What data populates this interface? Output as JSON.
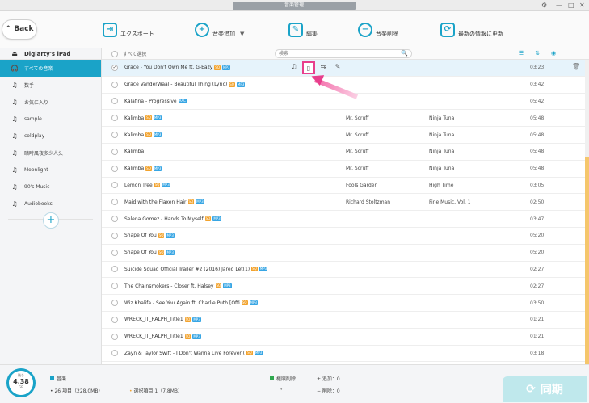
{
  "window": {
    "title": "音楽管理",
    "settings_icon": "⚙",
    "min_icon": "—",
    "max_icon": "□",
    "close_icon": "✕"
  },
  "toolbar": {
    "back_label": "Back",
    "back_icon": "⌃",
    "export_label": "エクスポート",
    "add_music_label": "音楽追加",
    "dropdown_icon": "▼",
    "edit_label": "編集",
    "delete_label": "音楽削除",
    "refresh_label": "最新の情報に更新"
  },
  "sidebar": {
    "device_name": "Digiarty's iPad",
    "items": [
      {
        "label": "すべての音楽",
        "icon": "🎧"
      },
      {
        "label": "数手",
        "icon": "♫"
      },
      {
        "label": "お気に入り",
        "icon": "♫"
      },
      {
        "label": "sample",
        "icon": "♫"
      },
      {
        "label": "coldplay",
        "icon": "♫"
      },
      {
        "label": "暗時風夜多少人头",
        "icon": "♫"
      },
      {
        "label": "Moonlight",
        "icon": "♫"
      },
      {
        "label": "90's Music",
        "icon": "♫"
      },
      {
        "label": "Audiobooks",
        "icon": "♫"
      }
    ],
    "add_icon": "+"
  },
  "list": {
    "select_all_label": "すべて選択",
    "search_placeholder": "検索",
    "search_icon": "🔍",
    "view_icons": [
      "☰",
      "⇅",
      "◉"
    ],
    "rows": [
      {
        "title": "Grace - You Don't Own Me ft. G-Eazy",
        "badges": [
          "SQ",
          "MP3"
        ],
        "artist": "",
        "album": "",
        "time": "03:23",
        "checked": "✓"
      },
      {
        "title": "Grace VanderWaal - Beautiful Thing (Lyric)",
        "badges": [
          "SQ",
          "MP3"
        ],
        "artist": "",
        "album": "",
        "time": "03:42",
        "checked": ""
      },
      {
        "title": "Kalafina - Progressive",
        "badges": [
          "AAC"
        ],
        "artist": "",
        "album": "",
        "time": "05:42",
        "checked": ""
      },
      {
        "title": "Kalimba",
        "badges": [
          "SQ",
          "MP3"
        ],
        "artist": "Mr. Scruff",
        "album": "Ninja Tuna",
        "time": "05:48",
        "checked": ""
      },
      {
        "title": "Kalimba",
        "badges": [
          "SQ",
          "MP3"
        ],
        "artist": "Mr. Scruff",
        "album": "Ninja Tuna",
        "time": "05:48",
        "checked": ""
      },
      {
        "title": "Kalimba",
        "badges": [],
        "artist": "Mr. Scruff",
        "album": "Ninja Tuna",
        "time": "05:48",
        "checked": ""
      },
      {
        "title": "Kalimba",
        "badges": [
          "SQ",
          "MP3"
        ],
        "artist": "Mr. Scruff",
        "album": "Ninja Tuna",
        "time": "05:48",
        "checked": ""
      },
      {
        "title": "Lemon Tree",
        "badges": [
          "SQ",
          "MP3"
        ],
        "artist": "Fools Garden",
        "album": "High Time",
        "time": "03:05",
        "checked": ""
      },
      {
        "title": "Maid with the Flaxen Hair",
        "badges": [
          "SQ",
          "MP3"
        ],
        "artist": "Richard Stoltzman",
        "album": "Fine Music, Vol. 1",
        "time": "02:50",
        "checked": ""
      },
      {
        "title": "Selena Gomez - Hands To Myself",
        "badges": [
          "SQ",
          "MP3"
        ],
        "artist": "",
        "album": "",
        "time": "03:47",
        "checked": ""
      },
      {
        "title": "Shape Of You",
        "badges": [
          "SQ",
          "MP3"
        ],
        "artist": "",
        "album": "",
        "time": "05:20",
        "checked": ""
      },
      {
        "title": "Shape Of You",
        "badges": [
          "SQ",
          "MP3"
        ],
        "artist": "",
        "album": "",
        "time": "05:20",
        "checked": ""
      },
      {
        "title": "Suicide Squad Official Trailer #2 (2016) Jared Let(1)",
        "badges": [
          "SQ",
          "MP3"
        ],
        "artist": "",
        "album": "",
        "time": "02:27",
        "checked": ""
      },
      {
        "title": "The Chainsmokers - Closer ft. Halsey",
        "badges": [
          "SQ",
          "MP3"
        ],
        "artist": "",
        "album": "",
        "time": "02:27",
        "checked": ""
      },
      {
        "title": "Wiz Khalifa - See You Again ft. Charlie Puth [Offi",
        "badges": [
          "SQ",
          "MP3"
        ],
        "artist": "",
        "album": "",
        "time": "03:50",
        "checked": ""
      },
      {
        "title": "WRECK_IT_RALPH_Title1",
        "badges": [
          "SQ",
          "MP3"
        ],
        "artist": "",
        "album": "",
        "time": "01:21",
        "checked": ""
      },
      {
        "title": "WRECK_IT_RALPH_Title1",
        "badges": [
          "SQ",
          "MP3"
        ],
        "artist": "",
        "album": "",
        "time": "01:21",
        "checked": ""
      },
      {
        "title": "Zayn & Taylor Swift - I Don't Wanna Live Forever (",
        "badges": [
          "SQ",
          "MP3"
        ],
        "artist": "",
        "album": "",
        "time": "03:18",
        "checked": ""
      }
    ],
    "row_action_icons": [
      "♫",
      "▯",
      "⇆",
      "✎"
    ],
    "trash_icon": "🗑"
  },
  "footer": {
    "storage_label": "残り",
    "storage_value": "4.38",
    "storage_unit": "GB",
    "music_label": "音楽",
    "items_summary": "26 項目（228.0MB）",
    "selected_summary": "選択項目 1（7.8MB）",
    "delete_marker_label": "権限削除",
    "add_label": "+ 追加：0",
    "remove_label": "− 削除：0",
    "sync_label": "同期",
    "sync_icon": "⟳",
    "colors": {
      "accent": "#1aa3c8",
      "music": "#1aa3c8",
      "delete": "#2fa84f",
      "selected": "#f2a32e"
    }
  }
}
